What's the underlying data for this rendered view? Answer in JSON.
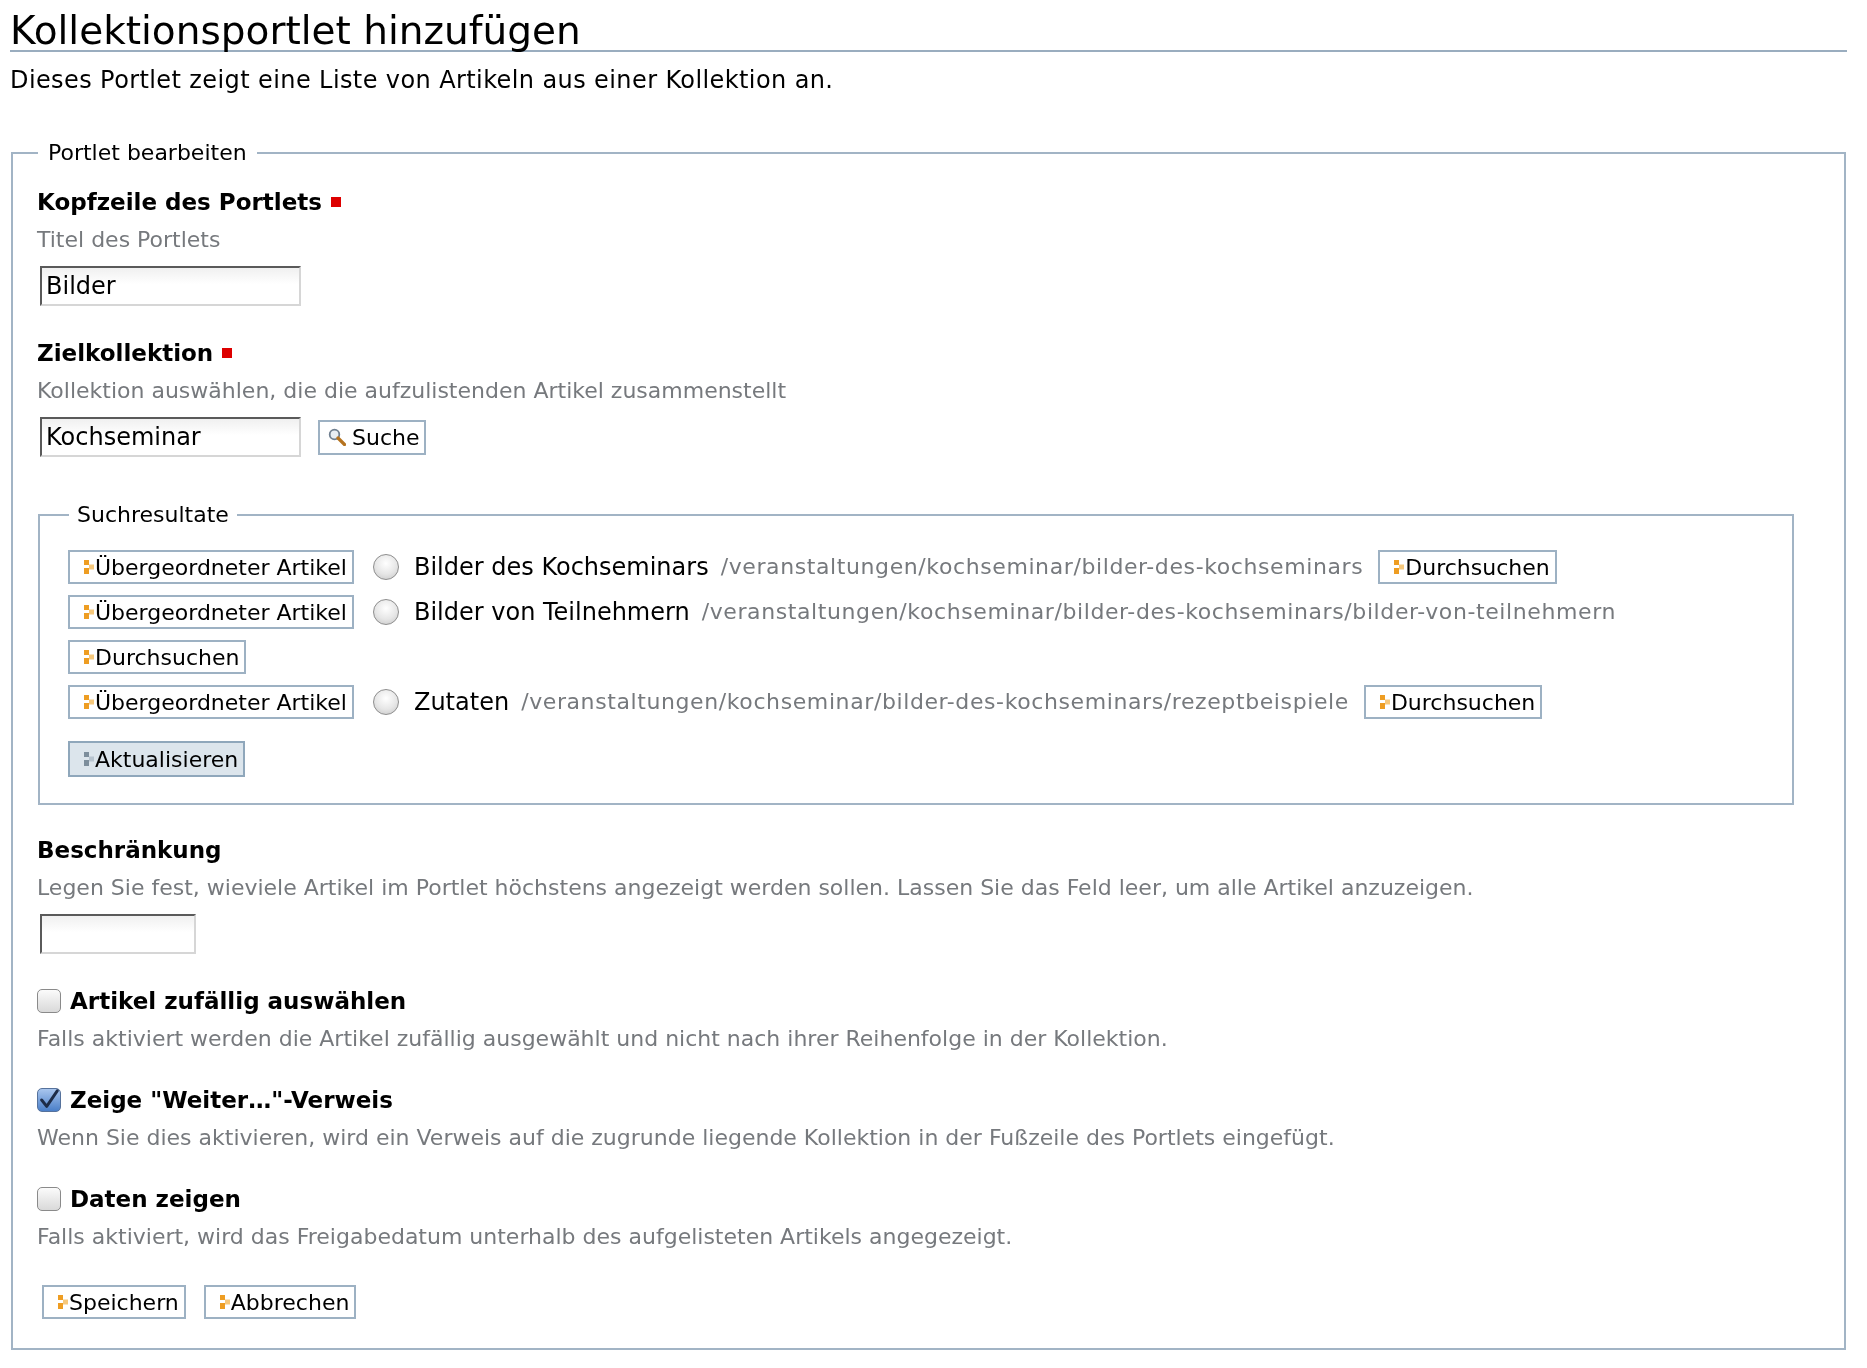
{
  "page": {
    "title": "Kollektionsportlet hinzufügen",
    "description": "Dieses Portlet zeigt eine Liste von Artikeln aus einer Kollektion an."
  },
  "form": {
    "legend": "Portlet bearbeiten",
    "fields": [
      {
        "kind": "text",
        "label": "Kopfzeile des Portlets",
        "required": true,
        "help": "Titel des Portlets",
        "value": "Bilder"
      },
      {
        "kind": "search",
        "label": "Zielkollektion",
        "required": true,
        "help": "Kollektion auswählen, die die aufzulistenden Artikel zusammenstellt",
        "value": "Kochseminar",
        "button": "Suche"
      },
      {
        "kind": "results",
        "legend": "Suchresultate",
        "items": [
          {
            "parent_button": "Übergeordneter Artikel",
            "selected": false,
            "title": "Bilder des Kochseminars",
            "path": "/veranstaltungen/kochseminar/bilder-des-kochseminars",
            "browse_button": "Durchsuchen"
          },
          {
            "parent_button": "Übergeordneter Artikel",
            "selected": false,
            "title": "Bilder von Teilnehmern",
            "path": "/veranstaltungen/kochseminar/bilder-des-kochseminars/bilder-von-teilnehmern",
            "browse_button": "Durchsuchen"
          },
          {
            "parent_button": "Übergeordneter Artikel",
            "selected": false,
            "title": "Zutaten",
            "path": "/veranstaltungen/kochseminar/bilder-des-kochseminars/rezeptbeispiele",
            "browse_button": "Durchsuchen"
          }
        ],
        "button": "Aktualisieren"
      },
      {
        "kind": "number",
        "label": "Beschränkung",
        "required": false,
        "help": "Legen Sie fest, wieviele Artikel im Portlet höchstens angezeigt werden sollen. Lassen Sie das Feld leer, um alle Artikel anzuzeigen."
      },
      {
        "kind": "checkbox",
        "label": "Artikel zufällig auswählen",
        "checked": false,
        "help": "Falls aktiviert werden die Artikel zufällig ausgewählt und nicht nach ihrer Reihenfolge in der Kollektion."
      },
      {
        "kind": "checkbox",
        "label": "Zeige \"Weiter…\"-Verweis",
        "checked": true,
        "help": "Wenn Sie dies aktivieren, wird ein Verweis auf die zugrunde liegende Kollektion in der Fußzeile des Portlets eingefügt."
      },
      {
        "kind": "checkbox",
        "label": "Daten zeigen",
        "checked": false,
        "help": "Falls aktiviert, wird das Freigabedatum unterhalb des aufgelisteten Artikels angegezeigt."
      }
    ]
  },
  "buttons": [
    "Speichern",
    "Abbrechen"
  ]
}
